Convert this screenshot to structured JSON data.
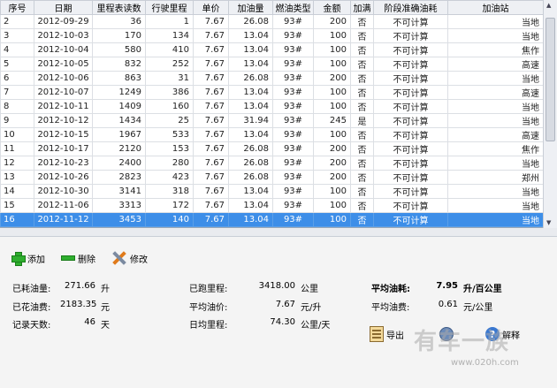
{
  "table": {
    "columns": [
      "序号",
      "日期",
      "里程表读数",
      "行驶里程",
      "单价",
      "加油量",
      "燃油类型",
      "金额",
      "加满",
      "阶段准确油耗",
      "加油站"
    ],
    "rows": [
      [
        "2",
        "2012-09-29",
        "36",
        "1",
        "7.67",
        "26.08",
        "93#",
        "200",
        "否",
        "不可计算",
        "当地"
      ],
      [
        "3",
        "2012-10-03",
        "170",
        "134",
        "7.67",
        "13.04",
        "93#",
        "100",
        "否",
        "不可计算",
        "当地"
      ],
      [
        "4",
        "2012-10-04",
        "580",
        "410",
        "7.67",
        "13.04",
        "93#",
        "100",
        "否",
        "不可计算",
        "焦作"
      ],
      [
        "5",
        "2012-10-05",
        "832",
        "252",
        "7.67",
        "13.04",
        "93#",
        "100",
        "否",
        "不可计算",
        "高速"
      ],
      [
        "6",
        "2012-10-06",
        "863",
        "31",
        "7.67",
        "26.08",
        "93#",
        "200",
        "否",
        "不可计算",
        "当地"
      ],
      [
        "7",
        "2012-10-07",
        "1249",
        "386",
        "7.67",
        "13.04",
        "93#",
        "100",
        "否",
        "不可计算",
        "高速"
      ],
      [
        "8",
        "2012-10-11",
        "1409",
        "160",
        "7.67",
        "13.04",
        "93#",
        "100",
        "否",
        "不可计算",
        "当地"
      ],
      [
        "9",
        "2012-10-12",
        "1434",
        "25",
        "7.67",
        "31.94",
        "93#",
        "245",
        "是",
        "不可计算",
        "当地"
      ],
      [
        "10",
        "2012-10-15",
        "1967",
        "533",
        "7.67",
        "13.04",
        "93#",
        "100",
        "否",
        "不可计算",
        "高速"
      ],
      [
        "11",
        "2012-10-17",
        "2120",
        "153",
        "7.67",
        "26.08",
        "93#",
        "200",
        "否",
        "不可计算",
        "焦作"
      ],
      [
        "12",
        "2012-10-23",
        "2400",
        "280",
        "7.67",
        "26.08",
        "93#",
        "200",
        "否",
        "不可计算",
        "当地"
      ],
      [
        "13",
        "2012-10-26",
        "2823",
        "423",
        "7.67",
        "26.08",
        "93#",
        "200",
        "否",
        "不可计算",
        "郑州"
      ],
      [
        "14",
        "2012-10-30",
        "3141",
        "318",
        "7.67",
        "13.04",
        "93#",
        "100",
        "否",
        "不可计算",
        "当地"
      ],
      [
        "15",
        "2012-11-06",
        "3313",
        "172",
        "7.67",
        "13.04",
        "93#",
        "100",
        "否",
        "不可计算",
        "当地"
      ],
      [
        "16",
        "2012-11-12",
        "3453",
        "140",
        "7.67",
        "13.04",
        "93#",
        "100",
        "否",
        "不可计算",
        "当地"
      ]
    ],
    "selected_row": "16"
  },
  "toolbar": {
    "add_label": "添加",
    "delete_label": "删除",
    "edit_label": "修改"
  },
  "stats": {
    "fuel_used": {
      "label": "已耗油量:",
      "value": "271.66",
      "unit": "升"
    },
    "money_spent": {
      "label": "已花油费:",
      "value": "2183.35",
      "unit": "元"
    },
    "record_days": {
      "label": "记录天数:",
      "value": "46",
      "unit": "天"
    },
    "distance": {
      "label": "已跑里程:",
      "value": "3418.00",
      "unit": "公里"
    },
    "avg_price": {
      "label": "平均油价:",
      "value": "7.67",
      "unit": "元/升"
    },
    "daily_distance": {
      "label": "日均里程:",
      "value": "74.30",
      "unit": "公里/天"
    },
    "avg_consumption": {
      "label": "平均油耗:",
      "value": "7.95",
      "unit": "升/百公里"
    },
    "avg_cost": {
      "label": "平均油费:",
      "value": "0.61",
      "unit": "元/公里"
    }
  },
  "bottom": {
    "export_label": "导出",
    "help_label": "解释"
  },
  "watermark": {
    "text": "有车一族",
    "url": "www.020h.com"
  },
  "colors": {
    "selection": "#3d8ee8",
    "add_icon": "#2eae2e"
  },
  "icons": {
    "add": "plus-icon",
    "delete": "minus-icon",
    "edit": "tools-icon",
    "export": "export-icon",
    "settings": "settings-icon",
    "help": "help-icon"
  }
}
